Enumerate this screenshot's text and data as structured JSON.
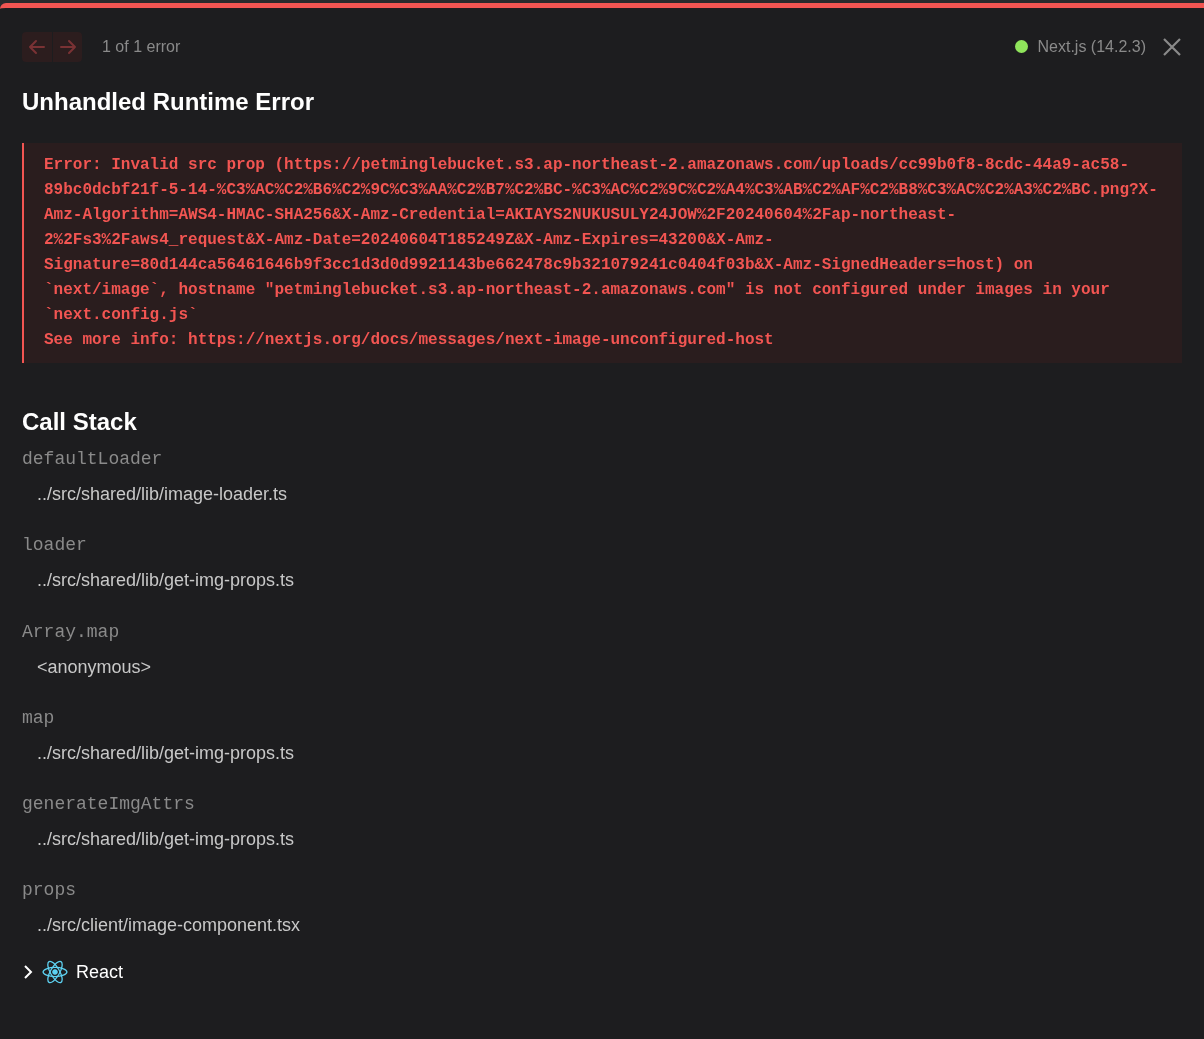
{
  "nav": {
    "buttons": [
      {
        "kind": "previous",
        "disabled": true
      },
      {
        "kind": "next",
        "disabled": true
      }
    ],
    "count": "1 of 1 error"
  },
  "version": {
    "label": "Next.js (14.2.3)",
    "color": "#8fe45b"
  },
  "title": "Unhandled Runtime Error",
  "error_lines": [
    "Error: Invalid src prop (https://petminglebucket.s3.ap-northeast-2.amazonaws.com/uploads/cc99b0f8-8cdc-44a9-ac58-",
    "89bc0dcbf21f-5-14-%C3%AC%C2%B6%C2%9C%C3%AA%C2%B7%C2%BC-%C3%AC%C2%9C%C2%A4%C3%AB%C2%AF%C2%B8%C3%AC%C2%A3%C2%BC.png?X-",
    "Amz-Algorithm=AWS4-HMAC-SHA256&X-Amz-Credential=AKIAYS2NUKUSULY24JOW%2F20240604%2Fap-northeast-",
    "2%2Fs3%2Faws4_request&X-Amz-Date=20240604T185249Z&X-Amz-Expires=43200&X-Amz-",
    "Signature=80d144ca56461646b9f3cc1d3d0d9921143be662478c9b321079241c0404f03b&X-Amz-SignedHeaders=host) on",
    "`next/image`, hostname \"petminglebucket.s3.ap-northeast-2.amazonaws.com\" is not configured under images in your",
    "`next.config.js`",
    "See more info: https://nextjs.org/docs/messages/next-image-unconfigured-host"
  ],
  "call_stack": {
    "title": "Call Stack",
    "frames": [
      {
        "function": "defaultLoader",
        "location": "../src/shared/lib/image-loader.ts"
      },
      {
        "function": "loader",
        "location": "../src/shared/lib/get-img-props.ts"
      },
      {
        "function": "Array.map",
        "location": "<anonymous>"
      },
      {
        "function": "map",
        "location": "../src/shared/lib/get-img-props.ts"
      },
      {
        "function": "generateImgAttrs",
        "location": "../src/shared/lib/get-img-props.ts"
      },
      {
        "function": "props",
        "location": "../src/client/image-component.tsx"
      }
    ],
    "group": {
      "label": "React",
      "expanded": false
    }
  }
}
